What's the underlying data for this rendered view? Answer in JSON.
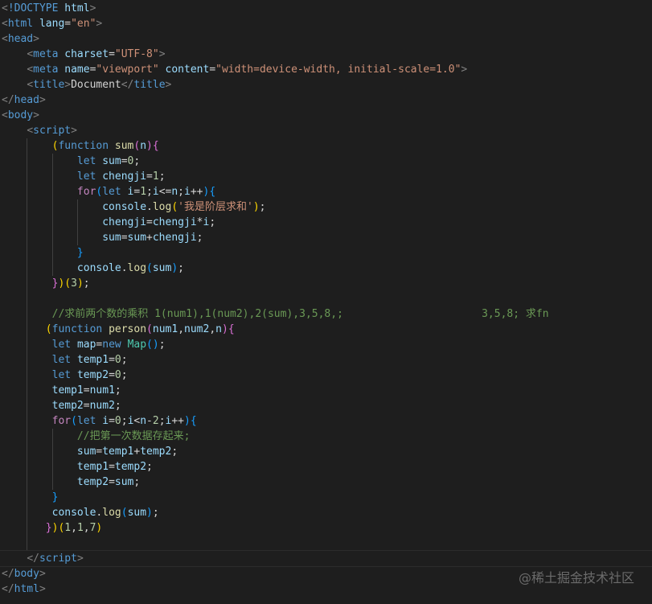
{
  "editor": {
    "watermark": "@稀土掘金技术社区",
    "lines": [
      {
        "indent": 0,
        "guides": [],
        "tokens": [
          [
            "<",
            "delim"
          ],
          [
            "!DOCTYPE",
            "tag"
          ],
          [
            " ",
            "text"
          ],
          [
            "html",
            "attr"
          ],
          [
            ">",
            "delim"
          ]
        ]
      },
      {
        "indent": 0,
        "guides": [],
        "tokens": [
          [
            "<",
            "delim"
          ],
          [
            "html",
            "tag"
          ],
          [
            " ",
            "text"
          ],
          [
            "lang",
            "attr"
          ],
          [
            "=",
            "op"
          ],
          [
            "\"en\"",
            "str"
          ],
          [
            ">",
            "delim"
          ]
        ]
      },
      {
        "indent": 0,
        "guides": [],
        "tokens": [
          [
            "<",
            "delim"
          ],
          [
            "head",
            "tag"
          ],
          [
            ">",
            "delim"
          ]
        ]
      },
      {
        "indent": 4,
        "guides": [],
        "tokens": [
          [
            "<",
            "delim"
          ],
          [
            "meta",
            "tag"
          ],
          [
            " ",
            "text"
          ],
          [
            "charset",
            "attr"
          ],
          [
            "=",
            "op"
          ],
          [
            "\"UTF-8\"",
            "str"
          ],
          [
            ">",
            "delim"
          ]
        ]
      },
      {
        "indent": 4,
        "guides": [],
        "tokens": [
          [
            "<",
            "delim"
          ],
          [
            "meta",
            "tag"
          ],
          [
            " ",
            "text"
          ],
          [
            "name",
            "attr"
          ],
          [
            "=",
            "op"
          ],
          [
            "\"viewport\"",
            "str"
          ],
          [
            " ",
            "text"
          ],
          [
            "content",
            "attr"
          ],
          [
            "=",
            "op"
          ],
          [
            "\"width=device-width, initial-scale=1.0\"",
            "str"
          ],
          [
            ">",
            "delim"
          ]
        ]
      },
      {
        "indent": 4,
        "guides": [],
        "tokens": [
          [
            "<",
            "delim"
          ],
          [
            "title",
            "tag"
          ],
          [
            ">",
            "delim"
          ],
          [
            "Document",
            "text"
          ],
          [
            "</",
            "delim"
          ],
          [
            "title",
            "tag"
          ],
          [
            ">",
            "delim"
          ]
        ]
      },
      {
        "indent": 0,
        "guides": [],
        "tokens": [
          [
            "</",
            "delim"
          ],
          [
            "head",
            "tag"
          ],
          [
            ">",
            "delim"
          ]
        ]
      },
      {
        "indent": 0,
        "guides": [],
        "tokens": [
          [
            "<",
            "delim"
          ],
          [
            "body",
            "tag"
          ],
          [
            ">",
            "delim"
          ]
        ]
      },
      {
        "indent": 4,
        "guides": [],
        "tokens": [
          [
            "<",
            "delim"
          ],
          [
            "script",
            "tag"
          ],
          [
            ">",
            "delim"
          ]
        ]
      },
      {
        "indent": 8,
        "guides": [
          4
        ],
        "tokens": [
          [
            "(",
            "p1"
          ],
          [
            "function",
            "kw"
          ],
          [
            " ",
            "text"
          ],
          [
            "sum",
            "fn"
          ],
          [
            "(",
            "p2"
          ],
          [
            "n",
            "var"
          ],
          [
            ")",
            "p2"
          ],
          [
            "{",
            "p2"
          ]
        ]
      },
      {
        "indent": 12,
        "guides": [
          4,
          8
        ],
        "tokens": [
          [
            "let",
            "kw"
          ],
          [
            " ",
            "text"
          ],
          [
            "sum",
            "var"
          ],
          [
            "=",
            "op"
          ],
          [
            "0",
            "num"
          ],
          [
            ";",
            "op"
          ]
        ]
      },
      {
        "indent": 12,
        "guides": [
          4,
          8
        ],
        "tokens": [
          [
            "let",
            "kw"
          ],
          [
            " ",
            "text"
          ],
          [
            "chengji",
            "var"
          ],
          [
            "=",
            "op"
          ],
          [
            "1",
            "num"
          ],
          [
            ";",
            "op"
          ]
        ]
      },
      {
        "indent": 12,
        "guides": [
          4,
          8
        ],
        "tokens": [
          [
            "for",
            "ctrl"
          ],
          [
            "(",
            "p3"
          ],
          [
            "let",
            "kw"
          ],
          [
            " ",
            "text"
          ],
          [
            "i",
            "var"
          ],
          [
            "=",
            "op"
          ],
          [
            "1",
            "num"
          ],
          [
            ";",
            "op"
          ],
          [
            "i",
            "var"
          ],
          [
            "<=",
            "op"
          ],
          [
            "n",
            "var"
          ],
          [
            ";",
            "op"
          ],
          [
            "i",
            "var"
          ],
          [
            "++",
            "op"
          ],
          [
            ")",
            "p3"
          ],
          [
            "{",
            "p3"
          ]
        ]
      },
      {
        "indent": 16,
        "guides": [
          4,
          8,
          12
        ],
        "tokens": [
          [
            "console",
            "var"
          ],
          [
            ".",
            "op"
          ],
          [
            "log",
            "fn"
          ],
          [
            "(",
            "p1"
          ],
          [
            "'我是阶层求和'",
            "str"
          ],
          [
            ")",
            "p1"
          ],
          [
            ";",
            "op"
          ]
        ]
      },
      {
        "indent": 16,
        "guides": [
          4,
          8,
          12
        ],
        "tokens": [
          [
            "chengji",
            "var"
          ],
          [
            "=",
            "op"
          ],
          [
            "chengji",
            "var"
          ],
          [
            "*",
            "op"
          ],
          [
            "i",
            "var"
          ],
          [
            ";",
            "op"
          ]
        ]
      },
      {
        "indent": 16,
        "guides": [
          4,
          8,
          12
        ],
        "tokens": [
          [
            "sum",
            "var"
          ],
          [
            "=",
            "op"
          ],
          [
            "sum",
            "var"
          ],
          [
            "+",
            "op"
          ],
          [
            "chengji",
            "var"
          ],
          [
            ";",
            "op"
          ]
        ]
      },
      {
        "indent": 12,
        "guides": [
          4,
          8
        ],
        "tokens": [
          [
            "}",
            "p3"
          ]
        ]
      },
      {
        "indent": 12,
        "guides": [
          4,
          8
        ],
        "tokens": [
          [
            "console",
            "var"
          ],
          [
            ".",
            "op"
          ],
          [
            "log",
            "fn"
          ],
          [
            "(",
            "p3"
          ],
          [
            "sum",
            "var"
          ],
          [
            ")",
            "p3"
          ],
          [
            ";",
            "op"
          ]
        ]
      },
      {
        "indent": 8,
        "guides": [
          4
        ],
        "tokens": [
          [
            "}",
            "p2"
          ],
          [
            ")",
            "p1"
          ],
          [
            "(",
            "p1"
          ],
          [
            "3",
            "num"
          ],
          [
            ")",
            "p1"
          ],
          [
            ";",
            "op"
          ]
        ]
      },
      {
        "indent": 0,
        "guides": [
          4
        ],
        "tokens": []
      },
      {
        "indent": 8,
        "guides": [
          4
        ],
        "tokens": [
          [
            "//求前两个数的乘积 1(num1),1(num2),2(sum),3,5,8,;                      3,5,8; 求fn",
            "com"
          ]
        ]
      },
      {
        "indent": 7,
        "guides": [
          4
        ],
        "tokens": [
          [
            "(",
            "p1"
          ],
          [
            "function",
            "kw"
          ],
          [
            " ",
            "text"
          ],
          [
            "person",
            "fn"
          ],
          [
            "(",
            "p2"
          ],
          [
            "num1",
            "var"
          ],
          [
            ",",
            "op"
          ],
          [
            "num2",
            "var"
          ],
          [
            ",",
            "op"
          ],
          [
            "n",
            "var"
          ],
          [
            ")",
            "p2"
          ],
          [
            "{",
            "p2"
          ]
        ]
      },
      {
        "indent": 8,
        "guides": [
          4
        ],
        "tokens": [
          [
            "let",
            "kw"
          ],
          [
            " ",
            "text"
          ],
          [
            "map",
            "var"
          ],
          [
            "=",
            "op"
          ],
          [
            "new",
            "kw"
          ],
          [
            " ",
            "text"
          ],
          [
            "Map",
            "cls"
          ],
          [
            "(",
            "p3"
          ],
          [
            ")",
            "p3"
          ],
          [
            ";",
            "op"
          ]
        ]
      },
      {
        "indent": 8,
        "guides": [
          4
        ],
        "tokens": [
          [
            "let",
            "kw"
          ],
          [
            " ",
            "text"
          ],
          [
            "temp1",
            "var"
          ],
          [
            "=",
            "op"
          ],
          [
            "0",
            "num"
          ],
          [
            ";",
            "op"
          ]
        ]
      },
      {
        "indent": 8,
        "guides": [
          4
        ],
        "tokens": [
          [
            "let",
            "kw"
          ],
          [
            " ",
            "text"
          ],
          [
            "temp2",
            "var"
          ],
          [
            "=",
            "op"
          ],
          [
            "0",
            "num"
          ],
          [
            ";",
            "op"
          ]
        ]
      },
      {
        "indent": 8,
        "guides": [
          4
        ],
        "tokens": [
          [
            "temp1",
            "var"
          ],
          [
            "=",
            "op"
          ],
          [
            "num1",
            "var"
          ],
          [
            ";",
            "op"
          ]
        ]
      },
      {
        "indent": 8,
        "guides": [
          4
        ],
        "tokens": [
          [
            "temp2",
            "var"
          ],
          [
            "=",
            "op"
          ],
          [
            "num2",
            "var"
          ],
          [
            ";",
            "op"
          ]
        ]
      },
      {
        "indent": 8,
        "guides": [
          4
        ],
        "tokens": [
          [
            "for",
            "ctrl"
          ],
          [
            "(",
            "p3"
          ],
          [
            "let",
            "kw"
          ],
          [
            " ",
            "text"
          ],
          [
            "i",
            "var"
          ],
          [
            "=",
            "op"
          ],
          [
            "0",
            "num"
          ],
          [
            ";",
            "op"
          ],
          [
            "i",
            "var"
          ],
          [
            "<",
            "op"
          ],
          [
            "n",
            "var"
          ],
          [
            "-",
            "op"
          ],
          [
            "2",
            "num"
          ],
          [
            ";",
            "op"
          ],
          [
            "i",
            "var"
          ],
          [
            "++",
            "op"
          ],
          [
            ")",
            "p3"
          ],
          [
            "{",
            "p3"
          ]
        ]
      },
      {
        "indent": 12,
        "guides": [
          4,
          8
        ],
        "tokens": [
          [
            "//把第一次数据存起来;",
            "com"
          ]
        ]
      },
      {
        "indent": 12,
        "guides": [
          4,
          8
        ],
        "tokens": [
          [
            "sum",
            "var"
          ],
          [
            "=",
            "op"
          ],
          [
            "temp1",
            "var"
          ],
          [
            "+",
            "op"
          ],
          [
            "temp2",
            "var"
          ],
          [
            ";",
            "op"
          ]
        ]
      },
      {
        "indent": 12,
        "guides": [
          4,
          8
        ],
        "tokens": [
          [
            "temp1",
            "var"
          ],
          [
            "=",
            "op"
          ],
          [
            "temp2",
            "var"
          ],
          [
            ";",
            "op"
          ]
        ]
      },
      {
        "indent": 12,
        "guides": [
          4,
          8
        ],
        "tokens": [
          [
            "temp2",
            "var"
          ],
          [
            "=",
            "op"
          ],
          [
            "sum",
            "var"
          ],
          [
            ";",
            "op"
          ]
        ]
      },
      {
        "indent": 8,
        "guides": [
          4
        ],
        "tokens": [
          [
            "}",
            "p3"
          ]
        ]
      },
      {
        "indent": 8,
        "guides": [
          4
        ],
        "tokens": [
          [
            "console",
            "var"
          ],
          [
            ".",
            "op"
          ],
          [
            "log",
            "fn"
          ],
          [
            "(",
            "p3"
          ],
          [
            "sum",
            "var"
          ],
          [
            ")",
            "p3"
          ],
          [
            ";",
            "op"
          ]
        ]
      },
      {
        "indent": 7,
        "guides": [
          4
        ],
        "tokens": [
          [
            "}",
            "p2"
          ],
          [
            ")",
            "p1"
          ],
          [
            "(",
            "p1"
          ],
          [
            "1",
            "num"
          ],
          [
            ",",
            "op"
          ],
          [
            "1",
            "num"
          ],
          [
            ",",
            "op"
          ],
          [
            "7",
            "num"
          ],
          [
            ")",
            "p1"
          ]
        ]
      },
      {
        "indent": 0,
        "guides": [
          4
        ],
        "tokens": []
      },
      {
        "indent": 4,
        "guides": [],
        "current": true,
        "tokens": [
          [
            "<",
            "delim"
          ],
          [
            "/",
            "delim"
          ],
          [
            "script",
            "tag"
          ],
          [
            ">",
            "delim"
          ]
        ]
      },
      {
        "indent": 0,
        "guides": [],
        "tokens": [
          [
            "</",
            "delim"
          ],
          [
            "body",
            "tag"
          ],
          [
            ">",
            "delim"
          ]
        ]
      },
      {
        "indent": 0,
        "guides": [],
        "tokens": [
          [
            "</",
            "delim"
          ],
          [
            "html",
            "tag"
          ],
          [
            ">",
            "delim"
          ]
        ]
      }
    ]
  }
}
